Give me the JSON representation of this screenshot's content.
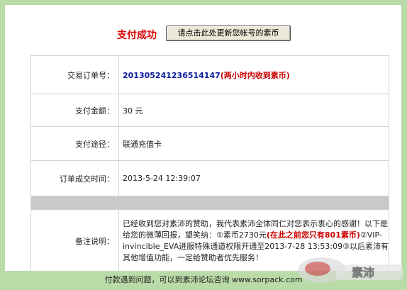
{
  "header": {
    "title": "支付成功",
    "refresh_button": "请点击此处更新您帐号的素币"
  },
  "rows": [
    {
      "label": "交易订单号：",
      "value": "201305241236514147",
      "note": "(两小时内收到素币)"
    },
    {
      "label": "支付金额：",
      "value": "30 元"
    },
    {
      "label": "支付途径：",
      "value": "联通充值卡"
    },
    {
      "label": "订单成交时间：",
      "value": "2013-5-24 12:39:07"
    }
  ],
  "remark": {
    "label": "备注说明：",
    "text_1": "已经收到您对素沛的赞助，我代表素沛全体同仁对您表示衷心的感谢！以下是给您的微薄回报，望笑纳：①素币2730元",
    "text_red": "(在此之前您只有801素币)",
    "text_2": "②VIP-invincible_EVA进服特殊通道权限开通至2013-7-28 13:53:09③以后素沛有其他增值功能，一定给赞助者优先服务！"
  },
  "footer": {
    "text": "付款遇到问题，可以到素沛论坛咨询",
    "link": "www.sorpack.com"
  },
  "watermark": {
    "text": "素沛"
  },
  "colors": {
    "frame": "#b9dba7",
    "title_red": "#dd0000",
    "order_blue": "#0b1a9a"
  }
}
